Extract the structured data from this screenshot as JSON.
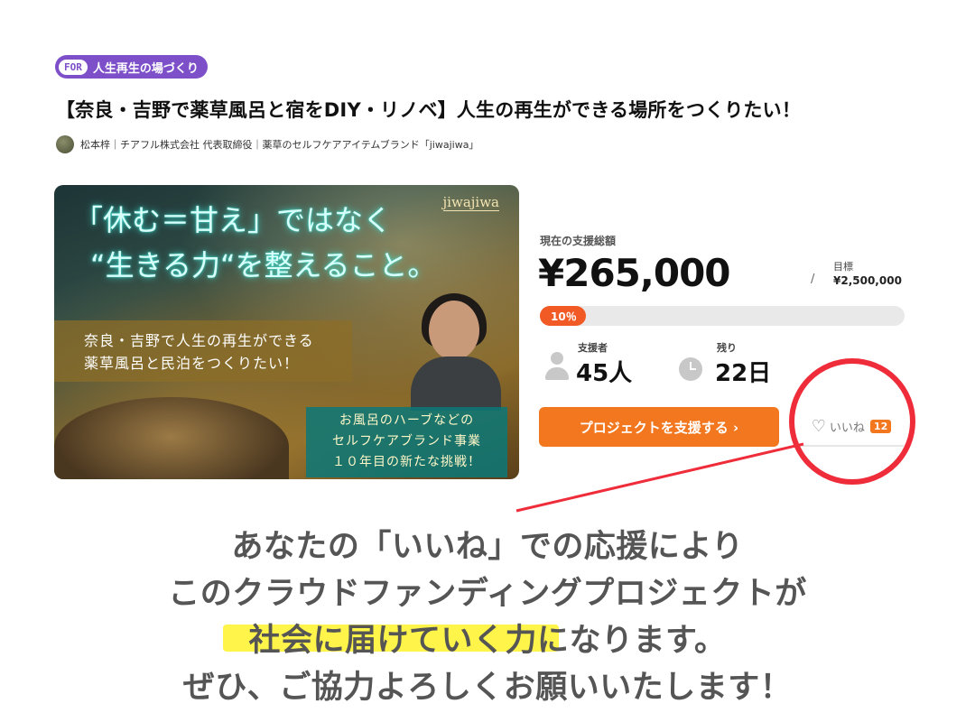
{
  "category": {
    "tag": "FOR",
    "label": "人生再生の場づくり"
  },
  "project": {
    "title": "【奈良・吉野で薬草風呂と宿をDIY・リノベ】人生の再生ができる場所をつくりたい！",
    "author": "松本梓｜チアフル株式会社 代表取締役｜薬草のセルフケアアイテムブランド「jiwajiwa」"
  },
  "hero": {
    "headline_1": "「休む＝甘え」ではなく",
    "headline_2": "“生きる力“を整えること。",
    "logo": "jiwajiwa",
    "band_1": "奈良・吉野で人生の再生ができる",
    "band_2": "薬草風呂と民泊をつくりたい！",
    "box_1": "お風呂のハーブなどの",
    "box_2": "セルフケアブランド事業",
    "box_3": "１０年目の新たな挑戦！"
  },
  "funding": {
    "label": "現在の支援総額",
    "amount": "¥265,000",
    "slash": "/",
    "goal_label": "目標",
    "goal_value": "¥2,500,000",
    "progress_text": "10％",
    "progress_fraction": 0.106
  },
  "stats": {
    "backers_label": "支援者",
    "backers_value": "45人",
    "days_label": "残り",
    "days_value": "22日"
  },
  "actions": {
    "support_label": "プロジェクトを支援する ›",
    "like_label": "いいね",
    "like_count": "12"
  },
  "message": {
    "line_1": "あなたの「いいね」での応援により",
    "line_2": "このクラウドファンディングプロジェクトが",
    "line_3": "社会に届けていく力になります。",
    "line_4": "ぜひ、ご協力よろしくお願いいたします！"
  },
  "colors": {
    "accent_orange": "#f2771f",
    "progress_red": "#f15a24",
    "highlight_red": "#ef2d3a",
    "badge_purple": "#7d4fc9",
    "marker_yellow": "#fff44a"
  },
  "icons": [
    "heart-icon",
    "person-icon",
    "clock-icon",
    "chevron-right-icon"
  ]
}
